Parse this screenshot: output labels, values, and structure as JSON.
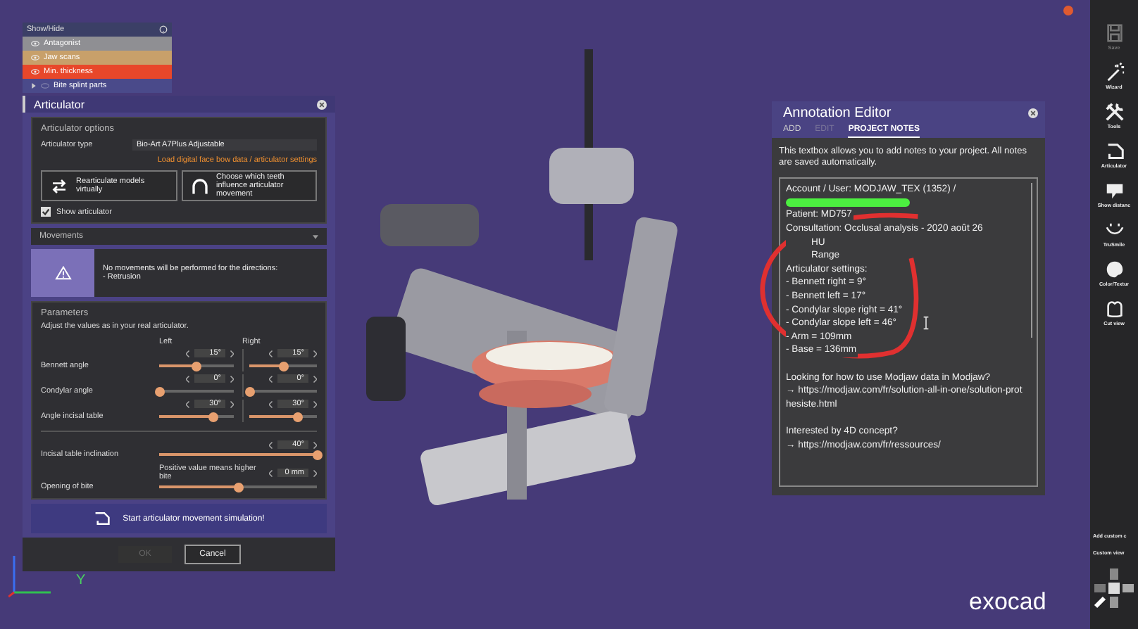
{
  "show_hide": {
    "title": "Show/Hide",
    "items": [
      {
        "label": "Antagonist",
        "color": "#8f8f93",
        "visible": true
      },
      {
        "label": "Jaw scans",
        "color": "#c8a06a",
        "visible": true
      },
      {
        "label": "Min. thickness",
        "color": "#e8472a",
        "visible": true
      },
      {
        "label": "Bite splint parts",
        "color": "#4a4a8a",
        "visible": false,
        "expanded": false
      }
    ]
  },
  "articulator": {
    "title": "Articulator",
    "options": {
      "title": "Articulator options",
      "type_label": "Articulator type",
      "type_value": "Bio-Art A7Plus Adjustable",
      "load_link": "Load digital face bow data / articulator settings",
      "buttons": [
        {
          "label": "Rearticulate models virtually",
          "kind": "swap"
        },
        {
          "label": "Choose which teeth influence articulator movement",
          "kind": "arch"
        }
      ],
      "show_articulator": {
        "label": "Show articulator",
        "checked": true
      }
    },
    "movements": {
      "label": "Movements",
      "expanded": false
    },
    "warning": {
      "text": "No movements will be performed for the directions:",
      "detail": "- Retrusion"
    },
    "parameters": {
      "title": "Parameters",
      "hint": "Adjust the values as in your real articulator.",
      "left": "Left",
      "right": "Right",
      "rows": [
        {
          "label": "Bennett angle",
          "left": {
            "value": "15°",
            "level": 0.5
          },
          "right": {
            "value": "15°",
            "level": 0.5
          }
        },
        {
          "label": "Condylar angle",
          "left": {
            "value": "0°",
            "level": 0.0
          },
          "right": {
            "value": "0°",
            "level": 0.0
          }
        },
        {
          "label": "Angle incisal table",
          "left": {
            "value": "30°",
            "level": 0.72
          },
          "right": {
            "value": "30°",
            "level": 0.72
          }
        }
      ],
      "wide": [
        {
          "label": "Incisal table inclination",
          "value": "40°",
          "level": 1.0
        },
        {
          "label": "Opening of bite",
          "note": "Positive value means higher bite",
          "value": "0 mm",
          "level": 0.5
        }
      ]
    },
    "start_button": "Start articulator movement simulation!",
    "ok": {
      "label": "OK",
      "disabled": true
    },
    "cancel": {
      "label": "Cancel",
      "disabled": false
    }
  },
  "annotation_editor": {
    "title": "Annotation Editor",
    "tabs": [
      {
        "label": "ADD",
        "selected": false,
        "disabled": false
      },
      {
        "label": "EDIT",
        "selected": false,
        "disabled": true
      },
      {
        "label": "PROJECT NOTES",
        "selected": true,
        "disabled": false
      }
    ],
    "description": "This textbox allows you to add notes to your project. All notes are saved automatically.",
    "notes": [
      {
        "lines": [
          {
            "kind": "line",
            "text": "Account / User: MODJAW_TEX (1352) /"
          },
          {
            "kind": "redacted"
          },
          {
            "kind": "line",
            "text": "Patient: MD757"
          },
          {
            "kind": "line",
            "text": "Consultation: Occlusal analysis - 2020 août 26"
          },
          {
            "kind": "fragment",
            "text": "HU"
          },
          {
            "kind": "fragment",
            "text": "Range"
          },
          {
            "kind": "line",
            "text": "Articulator settings:"
          },
          {
            "kind": "line",
            "text": "- Bennett right = 9°"
          },
          {
            "kind": "line",
            "text": "- Bennett left = 17°"
          },
          {
            "kind": "line",
            "text": "- Condylar slope right = 41°"
          },
          {
            "kind": "line",
            "text": "- Condylar slope left = 46°"
          },
          {
            "kind": "line",
            "text": "- Arm = 109mm"
          },
          {
            "kind": "line",
            "text": "- Base = 136mm"
          }
        ]
      },
      {
        "lines": [
          {
            "kind": "line",
            "text": "Looking for how to use Modjaw data in Modjaw?"
          },
          {
            "kind": "link",
            "text": "→ https://modjaw.com/fr/solution-all-in-one/solution-prothesiste.html"
          }
        ]
      },
      {
        "lines": [
          {
            "kind": "line",
            "text": "Interested by 4D concept?"
          },
          {
            "kind": "link",
            "text": "→ https://modjaw.com/fr/ressources/"
          }
        ]
      }
    ]
  },
  "toolbar": [
    {
      "label": "Save",
      "kind": "save",
      "disabled": true
    },
    {
      "label": "Wizard",
      "kind": "wand",
      "disabled": false
    },
    {
      "label": "Tools",
      "kind": "tools",
      "disabled": false
    },
    {
      "label": "Articulator",
      "kind": "articulator",
      "disabled": false
    },
    {
      "label": "Show distanc",
      "kind": "distance",
      "disabled": false
    },
    {
      "label": "TruSmile",
      "kind": "smile",
      "disabled": false
    },
    {
      "label": "Color/Textur",
      "kind": "palette",
      "disabled": false
    },
    {
      "label": "Cut view",
      "kind": "cut",
      "disabled": false
    }
  ],
  "custom_views": [
    "Add custom c",
    "Custom view"
  ],
  "axis_label": "Y",
  "brand": "exocad"
}
